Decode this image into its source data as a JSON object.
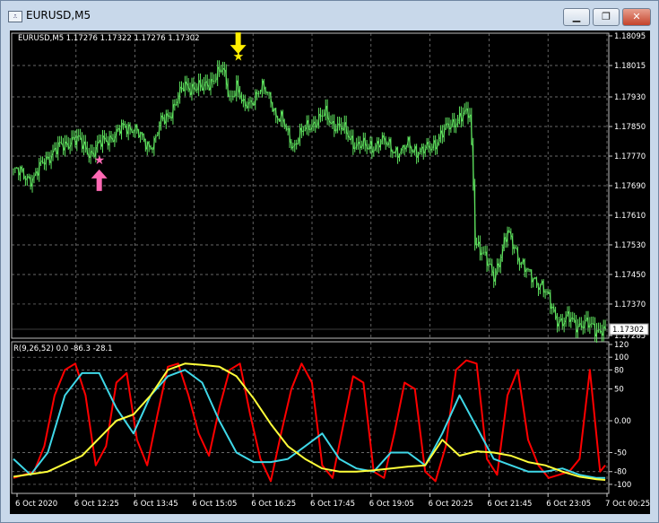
{
  "window": {
    "title": "EURUSD,M5",
    "icon_name": "chart-window-icon",
    "minimize_icon": "minimize-icon",
    "maximize_icon": "maximize-icon",
    "close_icon": "close-icon"
  },
  "main_panel": {
    "header": "EURUSD,M5  1.17276 1.17322 1.17276 1.17302",
    "current_price": "1.17302"
  },
  "sub_panel": {
    "header": "R(9,26,52) 0.0 -86.3 -28.1"
  },
  "colors": {
    "background": "#000000",
    "candles": "#5fe35f",
    "grid": "#8a8a8a",
    "up_arrow": "#ff69b4",
    "down_arrow": "#ffee00",
    "line_red": "#ff0000",
    "line_cyan": "#3fd8e8",
    "line_yellow": "#ffff3a"
  },
  "chart_data": [
    {
      "type": "candlestick",
      "symbol": "EURUSD",
      "timeframe": "M5",
      "last": 1.17302,
      "ylim": [
        1.17285,
        1.18095
      ],
      "y_tick_labels": [
        "1.18095",
        "1.18015",
        "1.17930",
        "1.17850",
        "1.17770",
        "1.17690",
        "1.17610",
        "1.17530",
        "1.17450",
        "1.17370",
        "1.17285"
      ],
      "x_tick_labels": [
        "6 Oct 2020",
        "6 Oct 12:25",
        "6 Oct 13:45",
        "6 Oct 15:05",
        "6 Oct 16:25",
        "6 Oct 17:45",
        "6 Oct 19:05",
        "6 Oct 20:25",
        "6 Oct 21:45",
        "6 Oct 23:05",
        "7 Oct 00:25"
      ],
      "close_path": [
        [
          0,
          1.1773
        ],
        [
          6,
          1.1772
        ],
        [
          12,
          1.1771
        ],
        [
          18,
          1.1776
        ],
        [
          22,
          1.1778
        ],
        [
          26,
          1.1779
        ],
        [
          30,
          1.178
        ],
        [
          34,
          1.1782
        ],
        [
          38,
          1.1781
        ],
        [
          42,
          1.1779
        ],
        [
          46,
          1.1778
        ],
        [
          50,
          1.178
        ],
        [
          55,
          1.1782
        ],
        [
          60,
          1.1783
        ],
        [
          65,
          1.1785
        ],
        [
          70,
          1.1785
        ],
        [
          74,
          1.1782
        ],
        [
          78,
          1.178
        ],
        [
          82,
          1.1781
        ],
        [
          86,
          1.1786
        ],
        [
          90,
          1.1788
        ],
        [
          95,
          1.1792
        ],
        [
          100,
          1.1796
        ],
        [
          105,
          1.1796
        ],
        [
          110,
          1.1795
        ],
        [
          114,
          1.1797
        ],
        [
          118,
          1.1799
        ],
        [
          122,
          1.18
        ],
        [
          126,
          1.1793
        ],
        [
          130,
          1.1796
        ],
        [
          134,
          1.179
        ],
        [
          138,
          1.1792
        ],
        [
          142,
          1.1794
        ],
        [
          146,
          1.1795
        ],
        [
          150,
          1.1793
        ],
        [
          153,
          1.1788
        ],
        [
          157,
          1.1786
        ],
        [
          160,
          1.1783
        ],
        [
          163,
          1.178
        ],
        [
          166,
          1.1782
        ],
        [
          170,
          1.1784
        ],
        [
          174,
          1.1786
        ],
        [
          178,
          1.1787
        ],
        [
          182,
          1.1788
        ],
        [
          186,
          1.1786
        ],
        [
          190,
          1.1785
        ],
        [
          194,
          1.1783
        ],
        [
          198,
          1.1781
        ],
        [
          202,
          1.178
        ],
        [
          206,
          1.1779
        ],
        [
          210,
          1.178
        ],
        [
          214,
          1.1781
        ],
        [
          218,
          1.178
        ],
        [
          222,
          1.1779
        ],
        [
          226,
          1.1778
        ],
        [
          230,
          1.178
        ],
        [
          234,
          1.1779
        ],
        [
          238,
          1.1778
        ],
        [
          242,
          1.1779
        ],
        [
          246,
          1.1781
        ],
        [
          250,
          1.1783
        ],
        [
          254,
          1.1785
        ],
        [
          258,
          1.1787
        ],
        [
          262,
          1.1788
        ],
        [
          266,
          1.1788
        ],
        [
          268,
          1.177
        ],
        [
          269,
          1.1755
        ],
        [
          272,
          1.1752
        ],
        [
          276,
          1.1748
        ],
        [
          280,
          1.1745
        ],
        [
          284,
          1.175
        ],
        [
          288,
          1.1756
        ],
        [
          292,
          1.1753
        ],
        [
          296,
          1.1748
        ],
        [
          300,
          1.1745
        ],
        [
          304,
          1.1744
        ],
        [
          308,
          1.1742
        ],
        [
          312,
          1.1738
        ],
        [
          316,
          1.1734
        ],
        [
          320,
          1.1732
        ],
        [
          324,
          1.1733
        ],
        [
          328,
          1.1732
        ],
        [
          332,
          1.17315
        ],
        [
          336,
          1.1731
        ],
        [
          340,
          1.17305
        ],
        [
          345,
          1.17302
        ]
      ],
      "n_bars": 346,
      "annotations": [
        {
          "type": "buy_arrow",
          "bar": 50,
          "price": 1.177,
          "color": "#ff69b4"
        },
        {
          "type": "buy_star",
          "bar": 50,
          "price": 1.1776,
          "color": "#ff69b4"
        },
        {
          "type": "sell_arrow",
          "bar": 131,
          "price": 1.1808,
          "color": "#ffee00"
        },
        {
          "type": "sell_star",
          "bar": 131,
          "price": 1.1804,
          "color": "#ffee00"
        }
      ]
    },
    {
      "type": "line",
      "indicator": "R(9,26,52)",
      "ylim": [
        -110,
        120
      ],
      "y_tick_labels": [
        "120",
        "100",
        "80",
        "50",
        "0.00",
        "-50",
        "-80",
        "-100"
      ],
      "levels": [
        100,
        80,
        50,
        0,
        -50,
        -80,
        -100
      ],
      "series": [
        {
          "name": "R9",
          "color": "#ff0000",
          "x": [
            0,
            6,
            12,
            18,
            24,
            30,
            36,
            42,
            48,
            54,
            60,
            66,
            72,
            78,
            84,
            90,
            96,
            102,
            108,
            114,
            120,
            126,
            132,
            138,
            144,
            150,
            156,
            162,
            168,
            174,
            180,
            186,
            192,
            198,
            204,
            210,
            216,
            222,
            228,
            234,
            240,
            246,
            252,
            258,
            264,
            270,
            276,
            282,
            288,
            294,
            300,
            306,
            312,
            318,
            324,
            330,
            336,
            342,
            345
          ],
          "values": [
            -90,
            -85,
            -80,
            -40,
            40,
            80,
            90,
            40,
            -70,
            -40,
            60,
            75,
            -30,
            -70,
            10,
            85,
            90,
            40,
            -20,
            -55,
            20,
            80,
            90,
            10,
            -60,
            -95,
            -20,
            50,
            90,
            60,
            -70,
            -90,
            -10,
            70,
            60,
            -80,
            -90,
            -20,
            60,
            50,
            -80,
            -95,
            -40,
            80,
            95,
            90,
            -60,
            -85,
            40,
            80,
            -30,
            -70,
            -90,
            -85,
            -80,
            -60,
            80,
            -80,
            -70
          ]
        },
        {
          "name": "R26",
          "color": "#3fd8e8",
          "x": [
            0,
            10,
            20,
            30,
            40,
            50,
            60,
            70,
            80,
            90,
            100,
            110,
            120,
            130,
            140,
            150,
            160,
            170,
            180,
            190,
            200,
            210,
            220,
            230,
            240,
            250,
            260,
            270,
            280,
            290,
            300,
            310,
            320,
            330,
            340,
            345
          ],
          "values": [
            -60,
            -85,
            -50,
            40,
            75,
            75,
            20,
            -20,
            40,
            70,
            80,
            60,
            0,
            -50,
            -65,
            -65,
            -60,
            -40,
            -20,
            -60,
            -75,
            -80,
            -50,
            -50,
            -70,
            -20,
            40,
            -10,
            -60,
            -70,
            -80,
            -80,
            -75,
            -85,
            -90,
            -90
          ]
        },
        {
          "name": "R52",
          "color": "#ffff3a",
          "x": [
            0,
            20,
            40,
            60,
            70,
            80,
            90,
            100,
            110,
            120,
            130,
            140,
            150,
            160,
            170,
            180,
            190,
            200,
            210,
            220,
            230,
            240,
            250,
            260,
            270,
            280,
            290,
            300,
            310,
            320,
            330,
            340,
            345
          ],
          "values": [
            -88,
            -80,
            -55,
            0,
            10,
            40,
            80,
            90,
            88,
            85,
            70,
            35,
            -5,
            -40,
            -60,
            -75,
            -80,
            -80,
            -78,
            -75,
            -72,
            -70,
            -30,
            -55,
            -48,
            -50,
            -55,
            -65,
            -70,
            -80,
            -88,
            -92,
            -93
          ]
        }
      ]
    }
  ]
}
